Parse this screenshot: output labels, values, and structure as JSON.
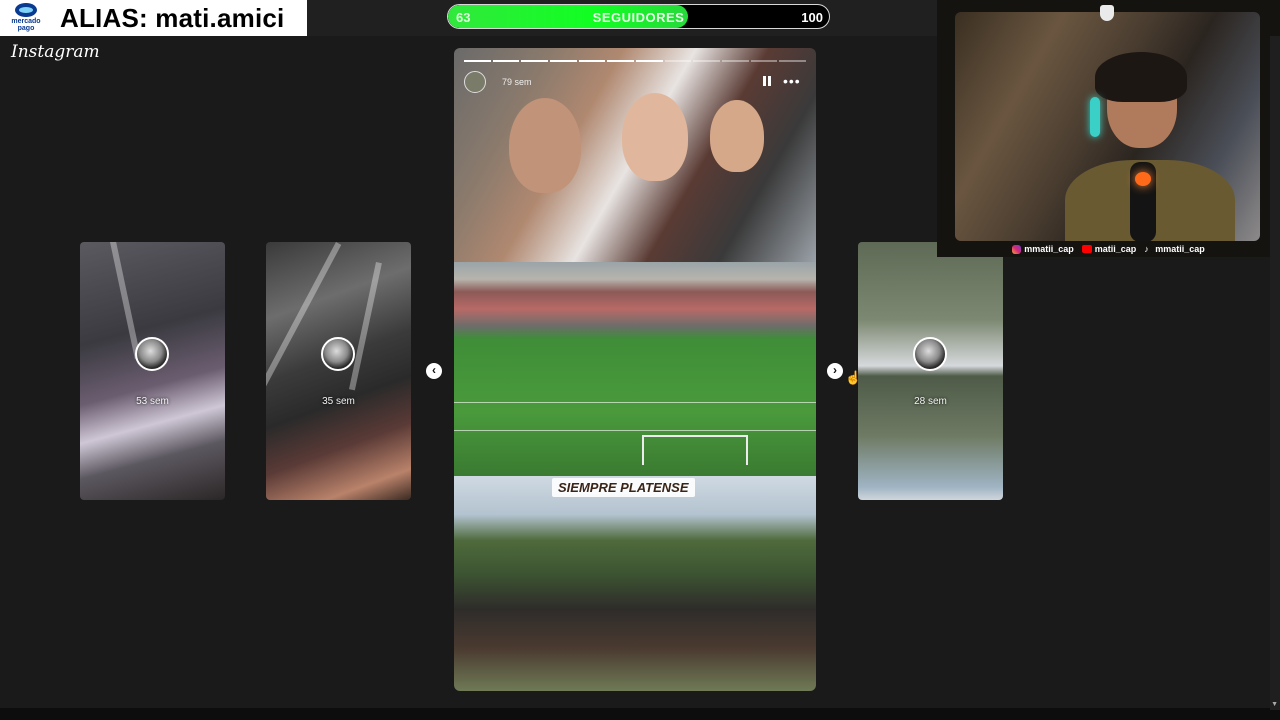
{
  "overlay": {
    "alias": "ALIAS: mati.amici",
    "mercado_pago_logo_text": "mercado pago"
  },
  "followers": {
    "current": "63",
    "label": "SEGUIDORES",
    "goal": "100",
    "progress_fraction": 0.63,
    "fill_color": "#11ff22"
  },
  "instagram": {
    "logo": "Instagram"
  },
  "stories": {
    "left": [
      {
        "time": "53 sem"
      },
      {
        "time": "35 sem"
      }
    ],
    "right": [
      {
        "time": "28 sem"
      }
    ],
    "main": {
      "time": "79 sem",
      "segments_total": 12,
      "segments_done": 7,
      "banner": "SIEMPRE PLATENSE",
      "more": "•••"
    },
    "prev_arrow": "‹",
    "next_arrow": "›"
  },
  "webcam": {
    "socials": [
      {
        "icon": "instagram-icon",
        "handle": "mmatii_cap"
      },
      {
        "icon": "youtube-icon",
        "handle": "matii_cap"
      },
      {
        "icon": "tiktok-icon",
        "handle": "mmatii_cap"
      }
    ]
  }
}
